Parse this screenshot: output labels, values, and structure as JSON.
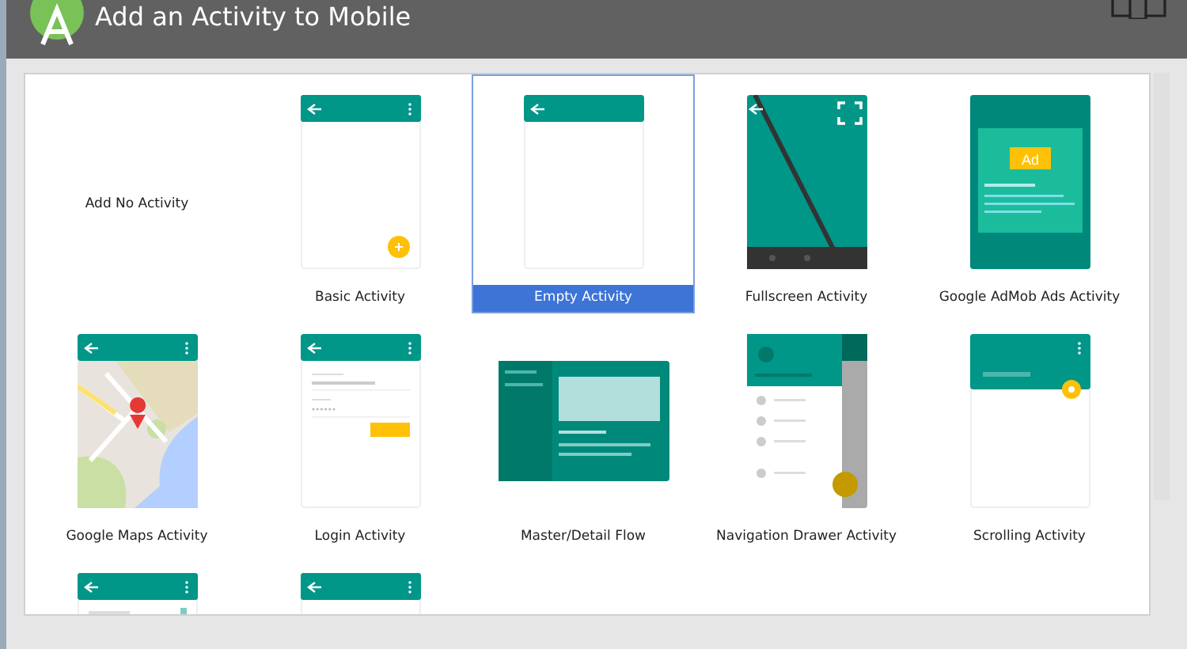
{
  "window": {
    "title": "Add an Activity to Mobile"
  },
  "items": [
    {
      "kind": "none",
      "label": "Add No Activity",
      "selected": false
    },
    {
      "kind": "basic",
      "label": "Basic Activity",
      "selected": false
    },
    {
      "kind": "empty",
      "label": "Empty Activity",
      "selected": true
    },
    {
      "kind": "fullscreen",
      "label": "Fullscreen Activity",
      "selected": false
    },
    {
      "kind": "admob",
      "label": "Google AdMob Ads Activity",
      "ad_badge": "Ad",
      "selected": false
    },
    {
      "kind": "maps",
      "label": "Google Maps Activity",
      "selected": false
    },
    {
      "kind": "login",
      "label": "Login Activity",
      "selected": false
    },
    {
      "kind": "master_detail",
      "label": "Master/Detail Flow",
      "selected": false
    },
    {
      "kind": "nav_drawer",
      "label": "Navigation Drawer Activity",
      "selected": false
    },
    {
      "kind": "scrolling",
      "label": "Scrolling Activity",
      "selected": false
    },
    {
      "kind": "settings",
      "selected": false
    },
    {
      "kind": "tabbed",
      "selected": false
    }
  ]
}
